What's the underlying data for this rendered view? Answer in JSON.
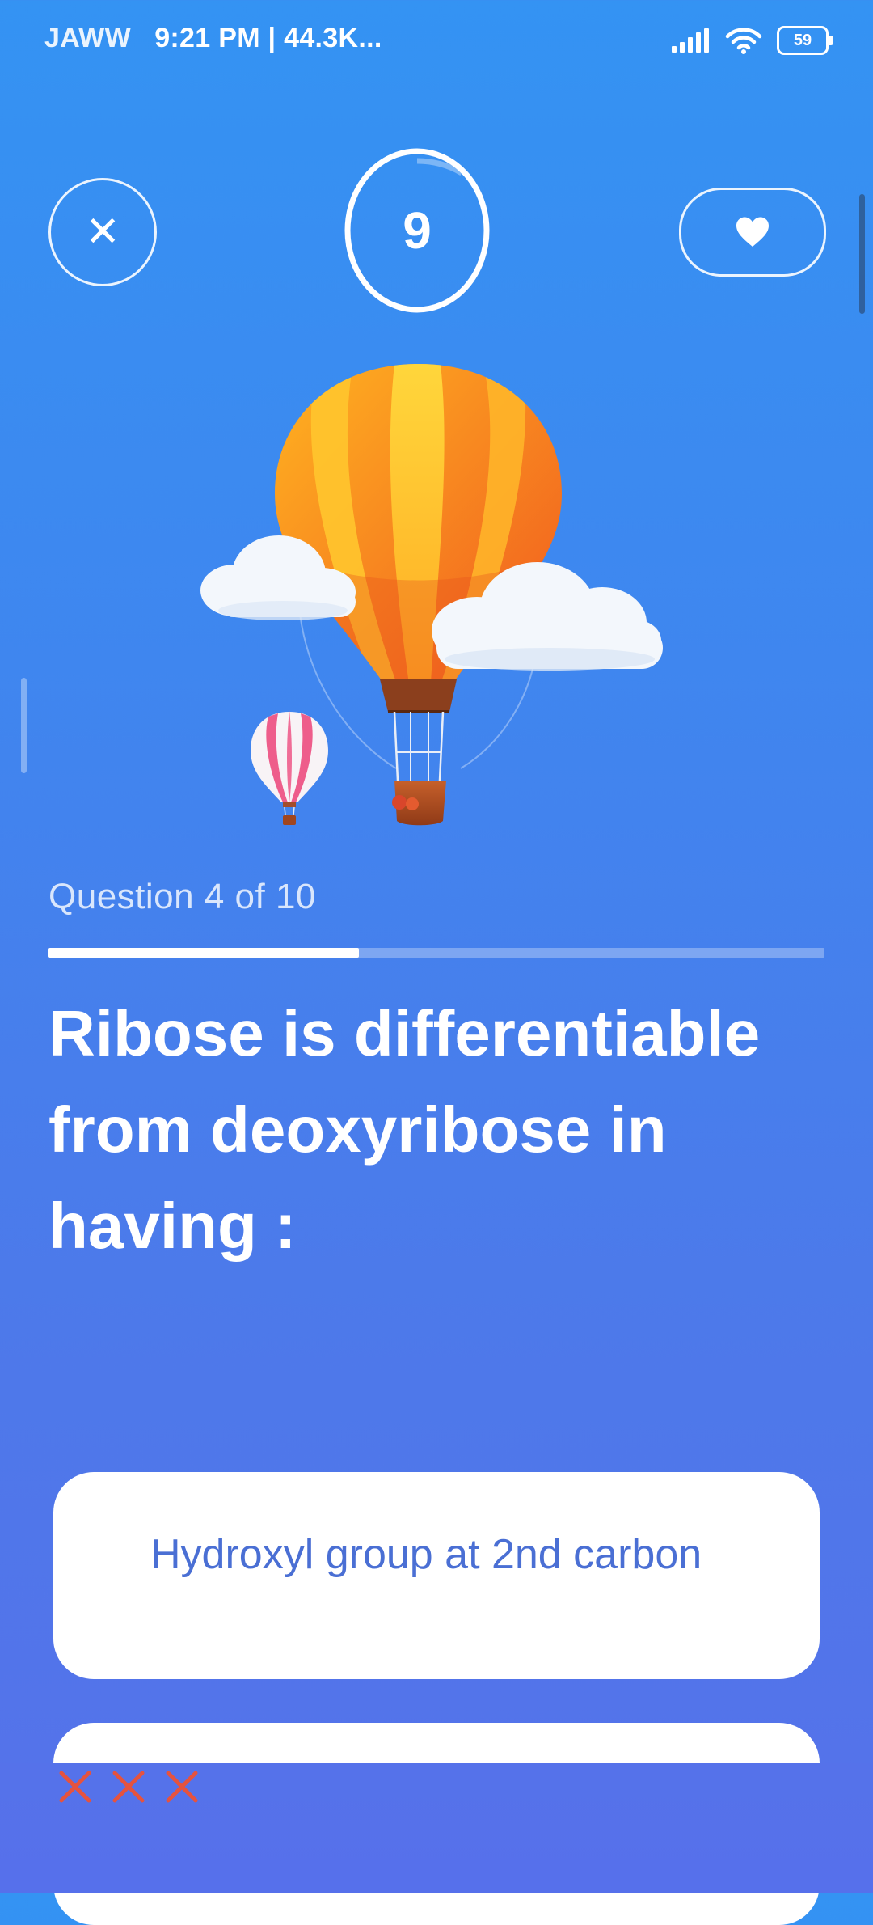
{
  "status_bar": {
    "carrier": "JAWW",
    "time_and_speed": "9:21 PM | 44.3K...",
    "battery_level": "59",
    "icons": [
      "signal-icon",
      "wifi-icon",
      "battery-icon"
    ]
  },
  "header": {
    "close_icon": "close-icon",
    "timer_value": "9",
    "timer_progress": 0.1,
    "lives_icon": "heart-icon"
  },
  "illustration": {
    "name": "hot-air-balloons-illustration"
  },
  "quiz": {
    "counter": "Question 4 of 10",
    "progress_fraction": 0.4,
    "question": "Ribose is differentiable from deoxyribose in having :",
    "options": [
      {
        "label": "Hydroxyl group at 2nd carbon"
      },
      {
        "label": ""
      }
    ]
  },
  "strikes": {
    "count": 3,
    "icon": "red-x-icon"
  },
  "colors": {
    "background_top": "#3493f3",
    "background_bottom": "#5671ea",
    "option_text": "#4a6fd4",
    "strike": "#e5533f"
  }
}
